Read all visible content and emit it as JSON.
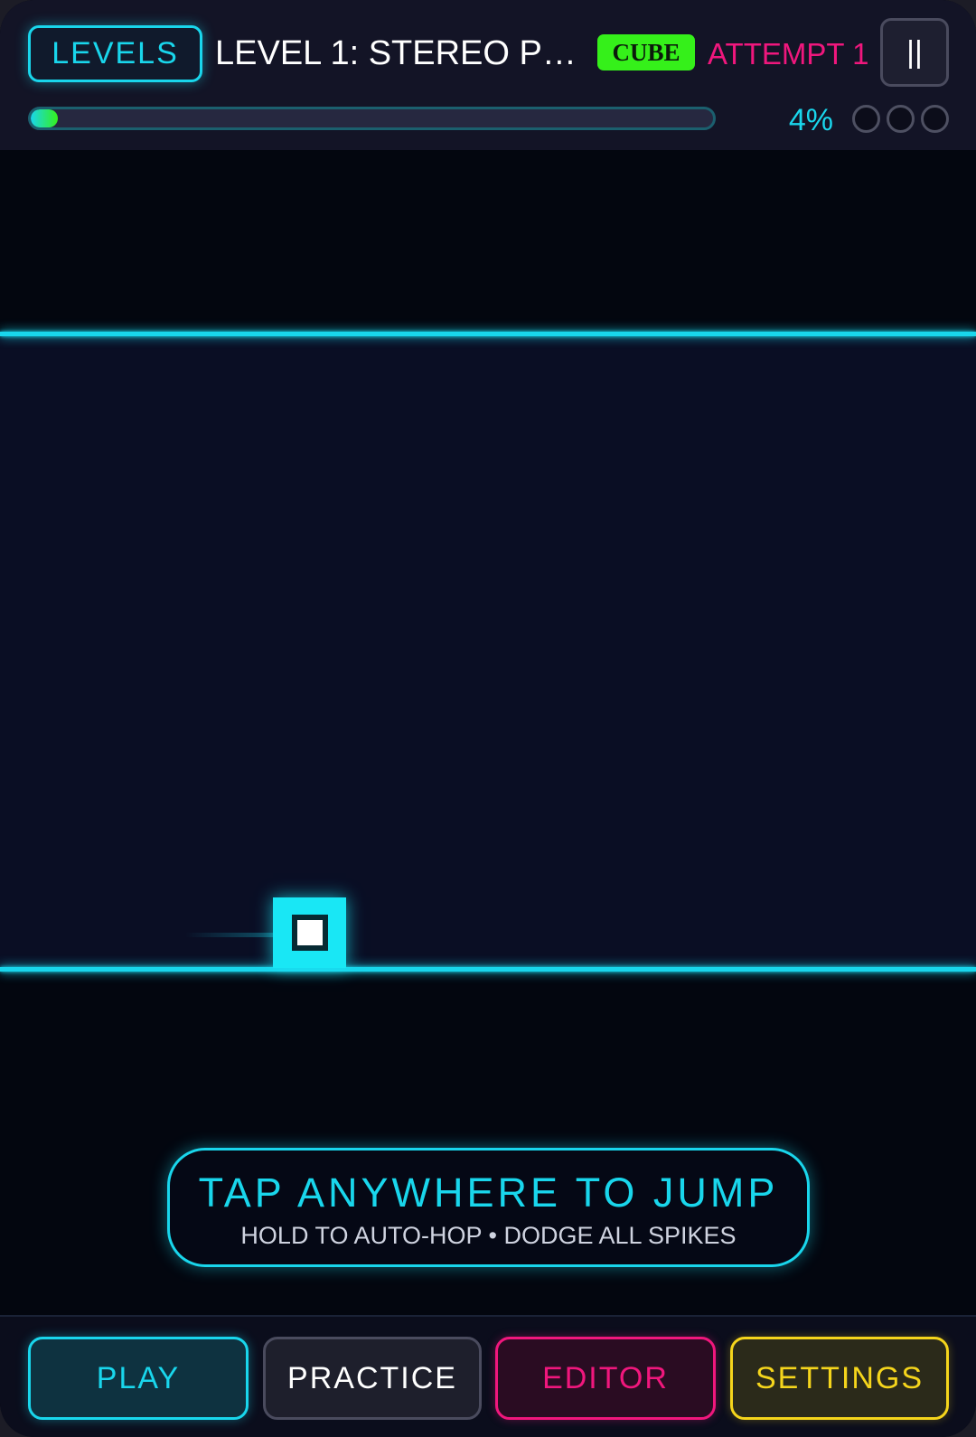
{
  "hud": {
    "levels_label": "LEVELS",
    "level_title": "LEVEL 1: STEREO P…",
    "mode_badge": "CUBE",
    "attempt_label": "ATTEMPT 1",
    "pause_label": "||",
    "progress_percent": 4,
    "progress_text": "4%",
    "coins": [
      {
        "collected": false
      },
      {
        "collected": false
      },
      {
        "collected": false
      }
    ]
  },
  "hint": {
    "main": "TAP ANYWHERE TO JUMP",
    "sub": "HOLD TO AUTO-HOP • DODGE ALL SPIKES"
  },
  "bottom_nav": {
    "play": "PLAY",
    "practice": "PRACTICE",
    "editor": "EDITOR",
    "settings": "SETTINGS"
  },
  "colors": {
    "accent_cyan": "#19d6ec",
    "accent_pink": "#f0177d",
    "accent_green": "#35f01a",
    "accent_yellow": "#f5d51c"
  },
  "icons": {
    "pause": "pause-icon",
    "player": "player-cube-icon"
  }
}
